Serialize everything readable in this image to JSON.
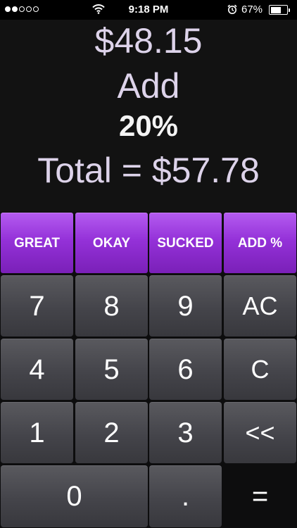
{
  "status_bar": {
    "time": "9:18 PM",
    "battery_percent": "67%",
    "battery_level": 0.67,
    "signal_bars_filled": 2,
    "signal_bars_total": 5,
    "icons": [
      "signal-dots-icon",
      "wifi-icon",
      "alarm-clock-icon",
      "battery-icon"
    ]
  },
  "display": {
    "bill": "$48.15",
    "action": "Add",
    "percent": "20%",
    "total": "Total = $57.78"
  },
  "presets": [
    "GREAT",
    "OKAY",
    "SUCKED",
    "ADD %"
  ],
  "keys": {
    "k7": "7",
    "k8": "8",
    "k9": "9",
    "ac": "AC",
    "k4": "4",
    "k5": "5",
    "k6": "6",
    "c": "C",
    "k1": "1",
    "k2": "2",
    "k3": "3",
    "back": "<<",
    "k0": "0",
    "dot": ".",
    "equals": "="
  },
  "colors": {
    "accent_purple": "#9431d8",
    "display_text": "#ddd3ea",
    "key_gray": "#44444a"
  }
}
